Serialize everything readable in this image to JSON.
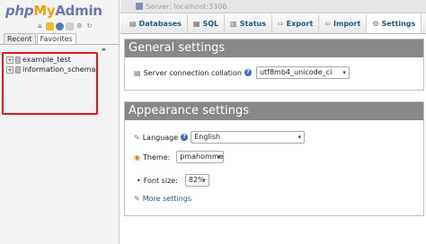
{
  "logo": {
    "php": "php",
    "my": "My",
    "admin": "Admin"
  },
  "nav": {
    "tabs": [
      "Recent",
      "Favorites"
    ],
    "databases": [
      "example_test",
      "information_schema"
    ]
  },
  "server_bar": {
    "text": "Server: localhost:3306"
  },
  "menu": {
    "items": [
      {
        "label": "Databases",
        "icon": "database-icon"
      },
      {
        "label": "SQL",
        "icon": "sql-icon"
      },
      {
        "label": "Status",
        "icon": "status-icon"
      },
      {
        "label": "Export",
        "icon": "export-icon"
      },
      {
        "label": "Import",
        "icon": "import-icon"
      },
      {
        "label": "Settings",
        "icon": "settings-icon"
      }
    ]
  },
  "general": {
    "title": "General settings",
    "collation_label": "Server connection collation",
    "collation_value": "utf8mb4_unicode_ci"
  },
  "appearance": {
    "title": "Appearance settings",
    "language_label": "Language",
    "language_value": "English",
    "theme_label": "Theme:",
    "theme_value": "pmahomme",
    "font_size_label": "Font size:",
    "font_size_value": "82%",
    "more_settings": "More settings"
  },
  "colors": {
    "highlight_border": "#e8141e",
    "panel_header": "#888888",
    "link": "#235a81",
    "logo_blue": "#6c78af",
    "logo_orange": "#f89c0e"
  }
}
